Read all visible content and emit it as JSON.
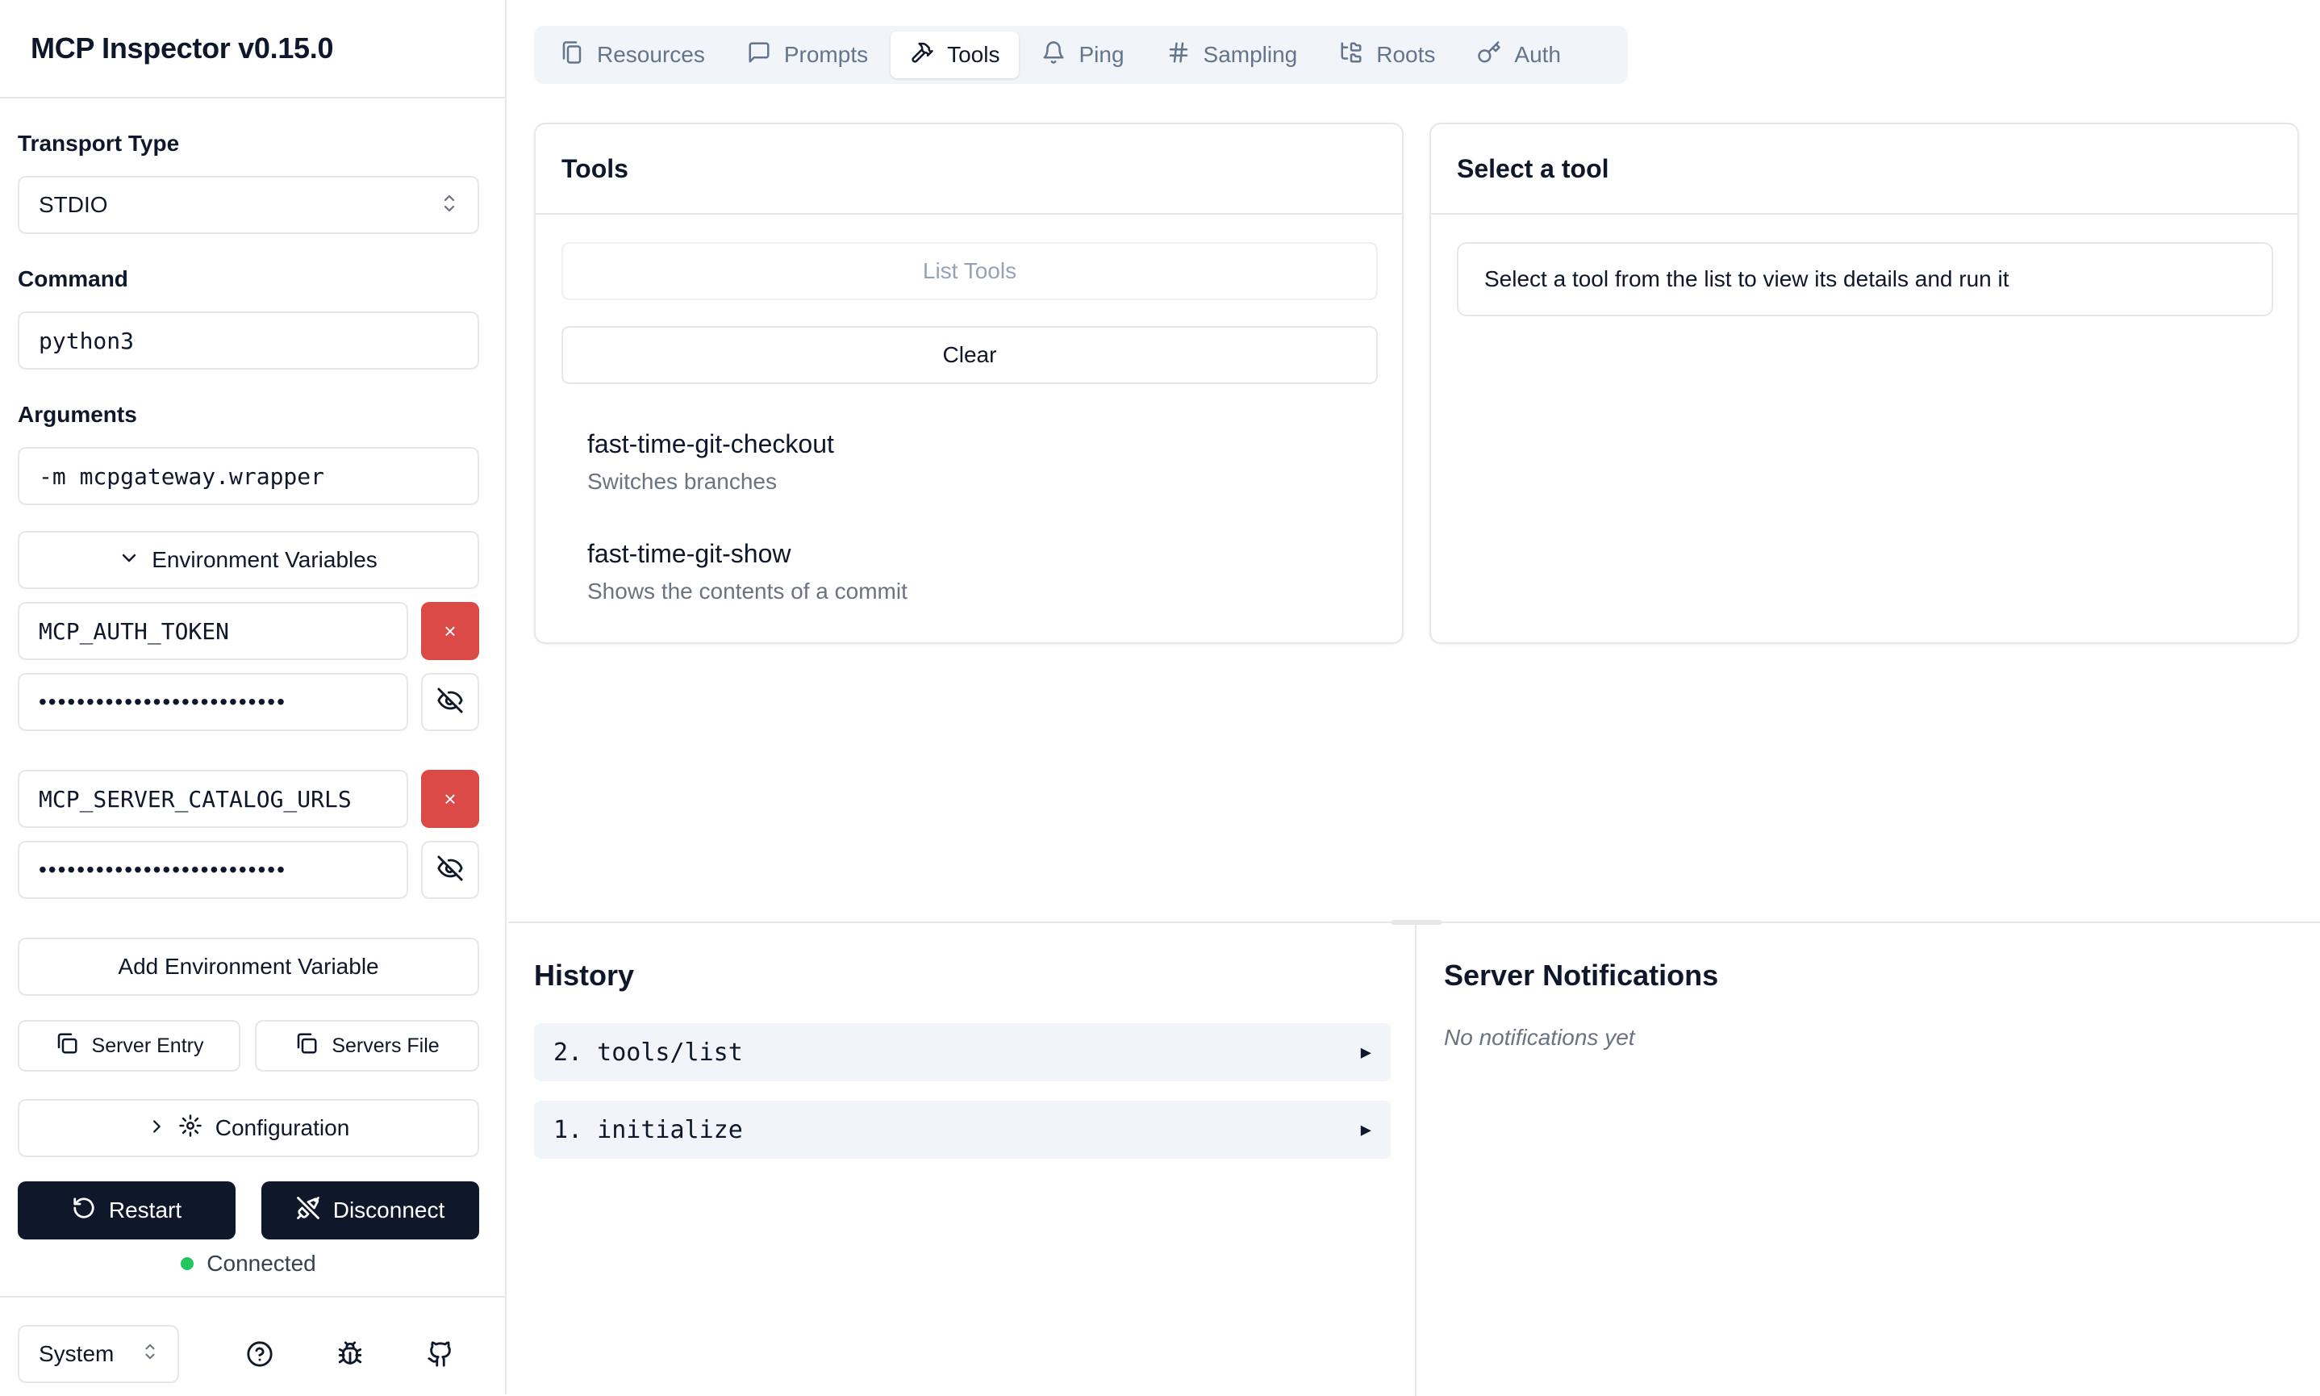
{
  "app": {
    "title": "MCP Inspector v0.15.0"
  },
  "sidebar": {
    "transport_label": "Transport Type",
    "transport_value": "STDIO",
    "command_label": "Command",
    "command_value": "python3",
    "arguments_label": "Arguments",
    "arguments_value": "-m mcpgateway.wrapper",
    "env_toggle_label": "Environment Variables",
    "env_vars": [
      {
        "key": "MCP_AUTH_TOKEN",
        "value_masked": "••••••••••••••••••••••••••"
      },
      {
        "key": "MCP_SERVER_CATALOG_URLS",
        "value_masked": "••••••••••••••••••••••••••"
      }
    ],
    "remove_label": "×",
    "add_env_label": "Add Environment Variable",
    "server_entry_label": "Server Entry",
    "servers_file_label": "Servers File",
    "configuration_label": "Configuration",
    "restart_label": "Restart",
    "disconnect_label": "Disconnect",
    "status_text": "Connected",
    "status_color": "#22c55e",
    "theme_value": "System"
  },
  "tabs": [
    {
      "label": "Resources",
      "icon": "files-icon",
      "active": false
    },
    {
      "label": "Prompts",
      "icon": "message-square-icon",
      "active": false
    },
    {
      "label": "Tools",
      "icon": "hammer-icon",
      "active": true
    },
    {
      "label": "Ping",
      "icon": "bell-icon",
      "active": false
    },
    {
      "label": "Sampling",
      "icon": "hash-icon",
      "active": false
    },
    {
      "label": "Roots",
      "icon": "folder-tree-icon",
      "active": false
    },
    {
      "label": "Auth",
      "icon": "key-icon",
      "active": false
    }
  ],
  "tools_panel": {
    "title": "Tools",
    "list_button": "List Tools",
    "clear_button": "Clear",
    "items": [
      {
        "name": "fast-time-git-checkout",
        "description": "Switches branches"
      },
      {
        "name": "fast-time-git-show",
        "description": "Shows the contents of a commit"
      }
    ]
  },
  "detail_panel": {
    "title": "Select a tool",
    "hint": "Select a tool from the list to view its details and run it"
  },
  "history": {
    "title": "History",
    "items": [
      {
        "label": "2. tools/list"
      },
      {
        "label": "1. initialize"
      }
    ],
    "expand_glyph": "▶"
  },
  "notifications": {
    "title": "Server Notifications",
    "empty_text": "No notifications yet"
  },
  "colors": {
    "primary_dark": "#0f172a",
    "danger": "#dc4a47",
    "border": "#e5e7eb",
    "muted_bg": "#f1f5f9"
  }
}
